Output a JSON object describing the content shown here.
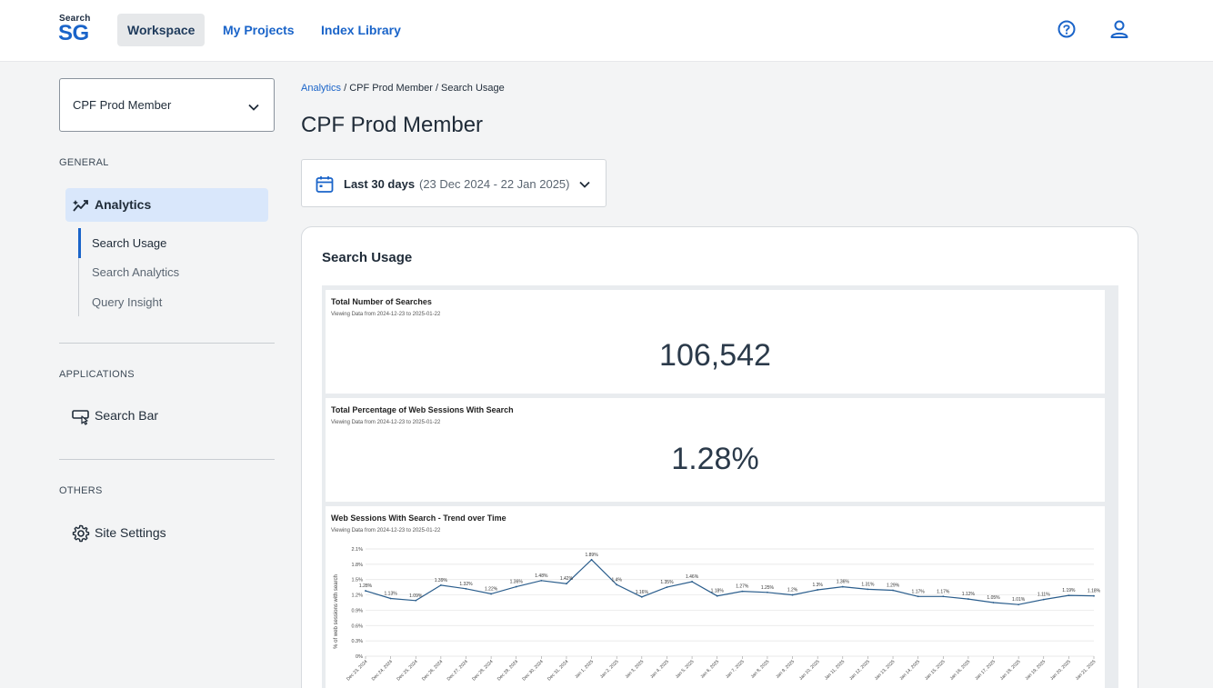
{
  "header": {
    "logo_small": "Search",
    "logo_big": "SG",
    "nav": [
      {
        "label": "Workspace",
        "active": true
      },
      {
        "label": "My Projects",
        "active": false
      },
      {
        "label": "Index Library",
        "active": false
      }
    ],
    "icons": [
      "help-icon",
      "user-icon"
    ]
  },
  "sidebar": {
    "site_select": "CPF Prod Member",
    "general_label": "GENERAL",
    "analytics_label": "Analytics",
    "sub_items": [
      "Search Usage",
      "Search Analytics",
      "Query Insight"
    ],
    "applications_label": "APPLICATIONS",
    "search_bar_label": "Search Bar",
    "others_label": "OTHERS",
    "site_settings_label": "Site Settings"
  },
  "main": {
    "breadcrumb_link": "Analytics",
    "breadcrumb_rest": " / CPF Prod Member / Search Usage",
    "title": "CPF Prod Member",
    "date_main": "Last 30 days",
    "date_range": "(23 Dec 2024 - 22 Jan 2025)",
    "card_title": "Search Usage",
    "panel1": {
      "title": "Total Number of Searches",
      "sub": "Viewing Data from 2024-12-23 to 2025-01-22",
      "value": "106,542"
    },
    "panel2": {
      "title": "Total Percentage of Web Sessions With Search",
      "sub": "Viewing Data from 2024-12-23 to 2025-01-22",
      "value": "1.28%"
    },
    "panel3": {
      "title": "Web Sessions With Search - Trend over Time",
      "sub": "Viewing Data from 2024-12-23 to 2025-01-22"
    }
  },
  "colors": {
    "accent": "#1a64c9",
    "line": "#2a5d8c"
  },
  "chart_data": {
    "type": "line",
    "title": "Web Sessions With Search - Trend over Time",
    "ylabel": "% of web sessions with search",
    "xlabel": "",
    "ylim": [
      0,
      2.1
    ],
    "yticks": [
      "0%",
      "0.3%",
      "0.6%",
      "0.9%",
      "1.2%",
      "1.5%",
      "1.8%",
      "2.1%"
    ],
    "ytick_values": [
      0,
      0.3,
      0.6,
      0.9,
      1.2,
      1.5,
      1.8,
      2.1
    ],
    "x": [
      "Dec 23, 2024",
      "Dec 24, 2024",
      "Dec 25, 2024",
      "Dec 26, 2024",
      "Dec 27, 2024",
      "Dec 28, 2024",
      "Dec 29, 2024",
      "Dec 30, 2024",
      "Dec 31, 2024",
      "Jan 1, 2025",
      "Jan 2, 2025",
      "Jan 3, 2025",
      "Jan 4, 2025",
      "Jan 5, 2025",
      "Jan 6, 2025",
      "Jan 7, 2025",
      "Jan 8, 2025",
      "Jan 9, 2025",
      "Jan 10, 2025",
      "Jan 11, 2025",
      "Jan 12, 2025",
      "Jan 13, 2025",
      "Jan 14, 2025",
      "Jan 15, 2025",
      "Jan 16, 2025",
      "Jan 17, 2025",
      "Jan 18, 2025",
      "Jan 19, 2025",
      "Jan 20, 2025",
      "Jan 21, 2025"
    ],
    "values": [
      1.28,
      1.13,
      1.09,
      1.39,
      1.32,
      1.22,
      1.36,
      1.48,
      1.42,
      1.89,
      1.4,
      1.16,
      1.35,
      1.46,
      1.18,
      1.27,
      1.25,
      1.2,
      1.3,
      1.36,
      1.31,
      1.29,
      1.17,
      1.17,
      1.12,
      1.05,
      1.01,
      1.11,
      1.19,
      1.18
    ],
    "data_labels": [
      "1.28%",
      "1.13%",
      "1.09%",
      "1.39%",
      "1.32%",
      "1.22%",
      "1.36%",
      "1.48%",
      "1.42%",
      "1.89%",
      "1.4%",
      "1.16%",
      "1.35%",
      "1.46%",
      "1.18%",
      "1.27%",
      "1.25%",
      "1.2%",
      "1.3%",
      "1.36%",
      "1.31%",
      "1.29%",
      "1.17%",
      "1.17%",
      "1.12%",
      "1.05%",
      "1.01%",
      "1.11%",
      "1.19%",
      "1.18%"
    ],
    "x_tick_labels": [
      "Dec 23, 2024",
      "Dec 24, 2024",
      "Dec 25, 2024",
      "Dec 26, 2024",
      "Dec 27, 2024",
      "Dec 28, 2024",
      "Dec 29, 2024",
      "Dec 30, 2024",
      "Dec 31, 2024",
      "Jan 1, 2025",
      "Jan 2, 2025",
      "Jan 3, 2025",
      "Jan 4, 2025",
      "Jan 5, 2025",
      "Jan 6, 2025",
      "Jan 7, 2025",
      "Jan 8, 2025",
      "Jan 9, 2025",
      "Jan 10, 2025",
      "Jan 11, 2025",
      "Jan 12, 2025",
      "Jan 13, 2025",
      "Jan 14, 2025",
      "Jan 15, 2025",
      "Jan 16, 2025",
      "Jan 17, 2025",
      "Jan 18, 2025",
      "Jan 19, 2025",
      "Jan 20, 2025",
      "Jan 21, 2025"
    ],
    "grid": true
  }
}
